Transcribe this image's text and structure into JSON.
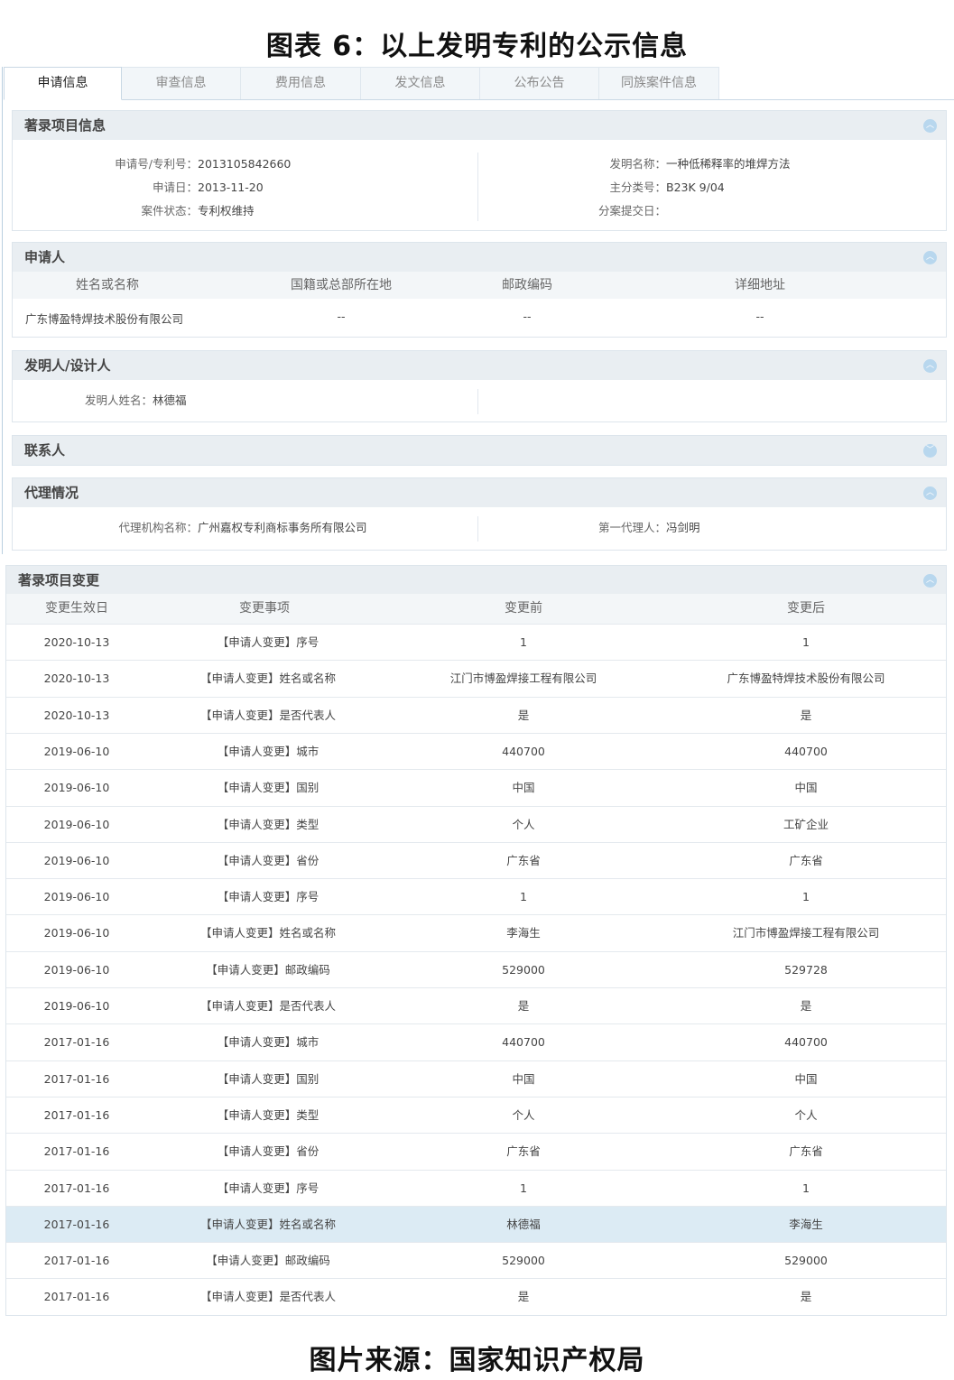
{
  "figure_title": "图表 6：以上发明专利的公示信息",
  "figure_source": "图片来源：国家知识产权局",
  "tabs": [
    "申请信息",
    "审查信息",
    "费用信息",
    "发文信息",
    "公布公告",
    "同族案件信息"
  ],
  "biblio": {
    "title": "著录项目信息",
    "app_no_label": "申请号/专利号：",
    "app_no": "2013105842660",
    "app_date_label": "申请日：",
    "app_date": "2013-11-20",
    "status_label": "案件状态：",
    "status": "专利权维持",
    "invention_label": "发明名称：",
    "invention": "一种低稀释率的堆焊方法",
    "ipc_label": "主分类号：",
    "ipc": "B23K 9/04",
    "div_label": "分案提交日：",
    "div": ""
  },
  "applicant": {
    "title": "申请人",
    "headers": [
      "姓名或名称",
      "国籍或总部所在地",
      "邮政编码",
      "详细地址"
    ],
    "row": [
      "广东博盈特焊技术股份有限公司",
      "--",
      "--",
      "--"
    ]
  },
  "inventor": {
    "title": "发明人/设计人",
    "label": "发明人姓名：",
    "value": "林德福"
  },
  "contact": {
    "title": "联系人"
  },
  "agency": {
    "title": "代理情况",
    "org_label": "代理机构名称：",
    "org": "广州嘉权专利商标事务所有限公司",
    "agent_label": "第一代理人：",
    "agent": "冯剑明"
  },
  "changes": {
    "title": "著录项目变更",
    "headers": [
      "变更生效日",
      "变更事项",
      "变更前",
      "变更后"
    ],
    "rows": [
      [
        "2020-10-13",
        "【申请人变更】序号",
        "1",
        "1"
      ],
      [
        "2020-10-13",
        "【申请人变更】姓名或名称",
        "江门市博盈焊接工程有限公司",
        "广东博盈特焊技术股份有限公司"
      ],
      [
        "2020-10-13",
        "【申请人变更】是否代表人",
        "是",
        "是"
      ],
      [
        "2019-06-10",
        "【申请人变更】城市",
        "440700",
        "440700"
      ],
      [
        "2019-06-10",
        "【申请人变更】国别",
        "中国",
        "中国"
      ],
      [
        "2019-06-10",
        "【申请人变更】类型",
        "个人",
        "工矿企业"
      ],
      [
        "2019-06-10",
        "【申请人变更】省份",
        "广东省",
        "广东省"
      ],
      [
        "2019-06-10",
        "【申请人变更】序号",
        "1",
        "1"
      ],
      [
        "2019-06-10",
        "【申请人变更】姓名或名称",
        "李海生",
        "江门市博盈焊接工程有限公司"
      ],
      [
        "2019-06-10",
        "【申请人变更】邮政编码",
        "529000",
        "529728"
      ],
      [
        "2019-06-10",
        "【申请人变更】是否代表人",
        "是",
        "是"
      ],
      [
        "2017-01-16",
        "【申请人变更】城市",
        "440700",
        "440700"
      ],
      [
        "2017-01-16",
        "【申请人变更】国别",
        "中国",
        "中国"
      ],
      [
        "2017-01-16",
        "【申请人变更】类型",
        "个人",
        "个人"
      ],
      [
        "2017-01-16",
        "【申请人变更】省份",
        "广东省",
        "广东省"
      ],
      [
        "2017-01-16",
        "【申请人变更】序号",
        "1",
        "1"
      ],
      [
        "2017-01-16",
        "【申请人变更】姓名或名称",
        "林德福",
        "李海生"
      ],
      [
        "2017-01-16",
        "【申请人变更】邮政编码",
        "529000",
        "529000"
      ],
      [
        "2017-01-16",
        "【申请人变更】是否代表人",
        "是",
        "是"
      ]
    ]
  },
  "icons": {
    "expanded": "chevron-up-icon",
    "collapsed": "chevron-down-icon"
  }
}
